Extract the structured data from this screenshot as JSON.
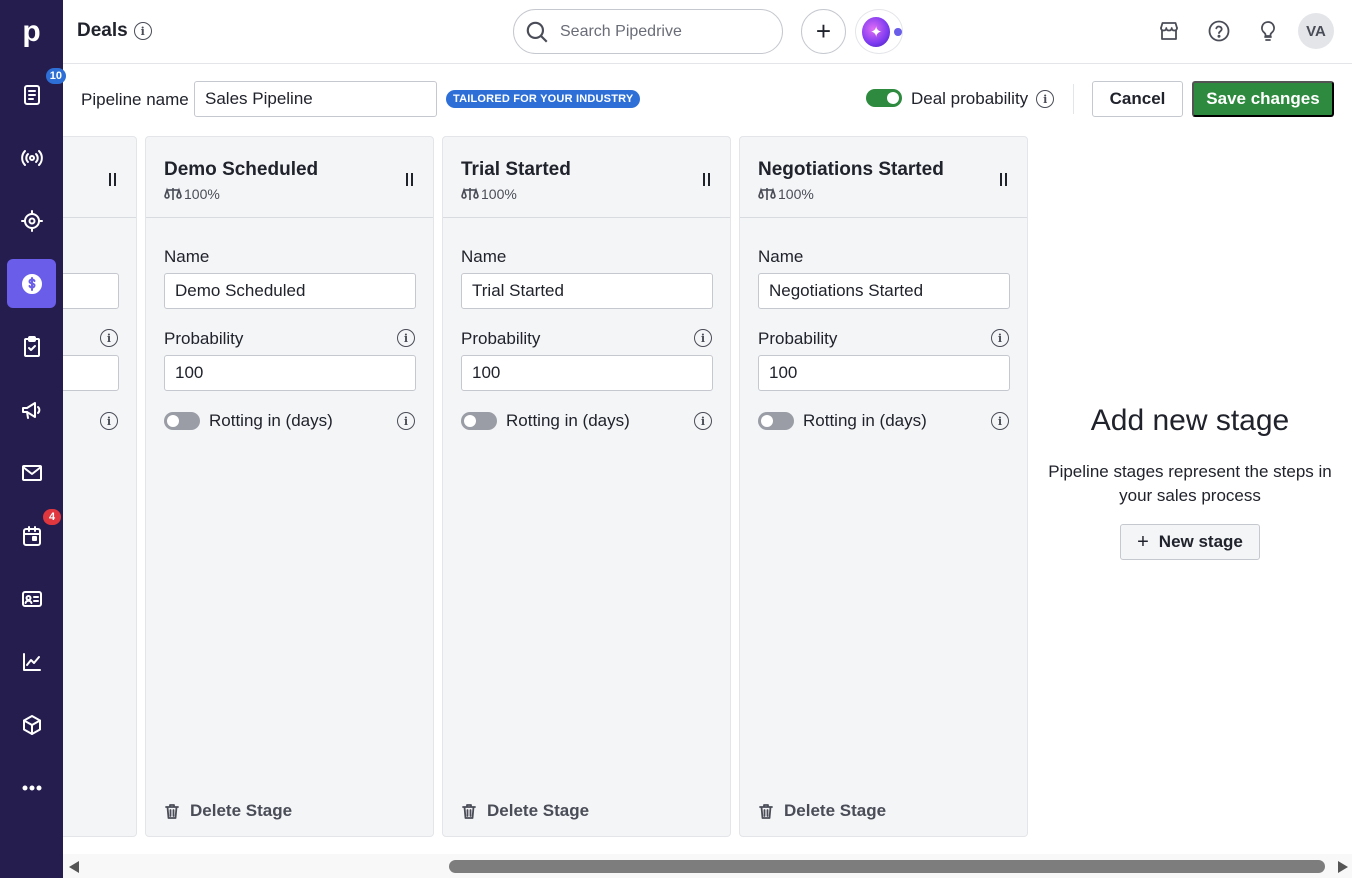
{
  "app": {
    "logo_letter": "p",
    "page_title": "Deals",
    "search_placeholder": "Search Pipedrive",
    "avatar_initials": "VA"
  },
  "sidebar": {
    "items": [
      {
        "name": "leads-inbox",
        "badge": "10",
        "badge_color": "#2d6fd6"
      },
      {
        "name": "campaigns-broadcast"
      },
      {
        "name": "target-goals"
      },
      {
        "name": "deals",
        "active": true
      },
      {
        "name": "activities-tasks"
      },
      {
        "name": "campaigns-megaphone"
      },
      {
        "name": "mail"
      },
      {
        "name": "calendar",
        "badge": "4",
        "badge_color": "#e0363e"
      },
      {
        "name": "contacts"
      },
      {
        "name": "insights"
      },
      {
        "name": "products"
      },
      {
        "name": "more"
      }
    ]
  },
  "pipeline": {
    "label": "Pipeline name",
    "name_value": "Sales Pipeline",
    "tailored_badge": "TAILORED FOR YOUR INDUSTRY",
    "deal_probability_label": "Deal probability",
    "deal_probability_enabled": true,
    "cancel_label": "Cancel",
    "save_label": "Save changes"
  },
  "stages": [
    {
      "title": "Demo Scheduled",
      "prob_text": "100%",
      "name_label": "Name",
      "name_value": "Demo Scheduled",
      "probability_label": "Probability",
      "probability_value": "100",
      "rotting_label": "Rotting in (days)",
      "rotting_enabled": false,
      "delete_label": "Delete Stage"
    },
    {
      "title": "Trial Started",
      "prob_text": "100%",
      "name_label": "Name",
      "name_value": "Trial Started",
      "probability_label": "Probability",
      "probability_value": "100",
      "rotting_label": "Rotting in (days)",
      "rotting_enabled": false,
      "delete_label": "Delete Stage"
    },
    {
      "title": "Negotiations Started",
      "prob_text": "100%",
      "name_label": "Name",
      "name_value": "Negotiations Started",
      "probability_label": "Probability",
      "probability_value": "100",
      "rotting_label": "Rotting in (days)",
      "rotting_enabled": false,
      "delete_label": "Delete Stage"
    }
  ],
  "add_stage": {
    "title": "Add new stage",
    "description": "Pipeline stages represent the steps in your sales process",
    "button_label": "New stage"
  },
  "colors": {
    "sidebar_bg": "#261d4f",
    "sidebar_active": "#6a5de9",
    "primary_green": "#2d8a3e",
    "badge_blue": "#2d6fd6"
  }
}
